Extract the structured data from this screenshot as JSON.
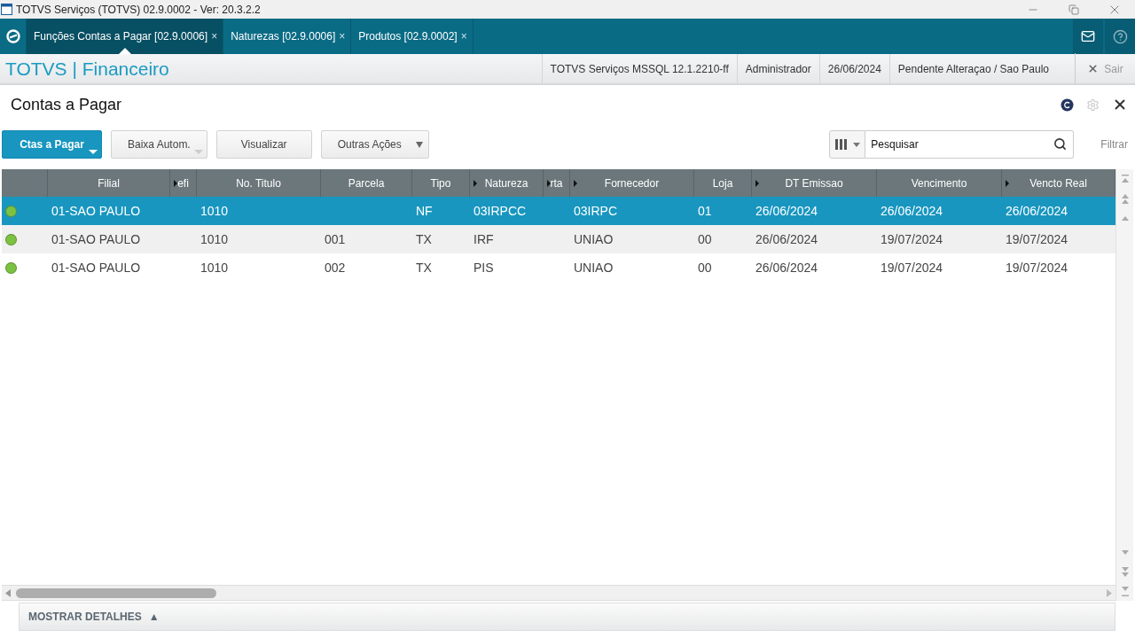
{
  "window": {
    "title": "TOTVS Serviços (TOTVS) 02.9.0002 - Ver: 20.3.2.2"
  },
  "tabs": [
    {
      "label": "Funções Contas a Pagar [02.9.0006]",
      "close": "×",
      "selected": true
    },
    {
      "label": "Naturezas [02.9.0006]",
      "close": "×",
      "selected": false
    },
    {
      "label": "Produtos [02.9.0002]",
      "close": "×",
      "selected": false
    }
  ],
  "app_bar": {
    "brand": "TOTVS | Financeiro",
    "info": [
      "TOTVS Serviços MSSQL 12.1.2210-ff",
      "Administrador",
      "26/06/2024",
      "Pendente Alteraçao / Sao Paulo"
    ],
    "exit": "Sair"
  },
  "page": {
    "title": "Contas a Pagar"
  },
  "actions": [
    {
      "label": "Ctas a Pagar",
      "kind": "primary",
      "dropdown": true
    },
    {
      "label": "Baixa Autom.",
      "kind": "secondary",
      "dropdown": true
    },
    {
      "label": "Visualizar",
      "kind": "secondary",
      "dropdown": false
    },
    {
      "label": "Outras Ações",
      "kind": "menu",
      "dropdown": false
    }
  ],
  "search": {
    "placeholder": "Pesquisar",
    "filter": "Filtrar"
  },
  "table": {
    "columns": [
      {
        "marker": false
      },
      {
        "label": "Filial",
        "marker": false
      },
      {
        "label": "efi",
        "marker": true
      },
      {
        "label": "No. Titulo",
        "marker": false
      },
      {
        "label": "Parcela",
        "marker": false
      },
      {
        "label": "Tipo",
        "marker": false
      },
      {
        "label": "Natureza",
        "marker": true
      },
      {
        "label": "rta",
        "marker": true
      },
      {
        "label": "Fornecedor",
        "marker": true
      },
      {
        "label": "Loja",
        "marker": false
      },
      {
        "label": "DT Emissao",
        "marker": true
      },
      {
        "label": "Vencimento",
        "marker": false
      },
      {
        "label": "Vencto Real",
        "marker": true
      }
    ],
    "rows": [
      {
        "selected": true,
        "color": "#7cc242",
        "cells": [
          "01-SAO PAULO",
          "",
          "1010",
          "",
          "NF",
          "03IRPCC",
          "",
          "03IRPC",
          "01",
          "26/06/2024",
          "26/06/2024",
          "26/06/2024"
        ]
      },
      {
        "selected": false,
        "color": "#7cc242",
        "cells": [
          "01-SAO PAULO",
          "",
          "1010",
          "001",
          "TX",
          "IRF",
          "",
          "UNIAO",
          "00",
          "26/06/2024",
          "19/07/2024",
          "19/07/2024"
        ]
      },
      {
        "selected": false,
        "color": "#7cc242",
        "cells": [
          "01-SAO PAULO",
          "",
          "1010",
          "002",
          "TX",
          "PIS",
          "",
          "UNIAO",
          "00",
          "26/06/2024",
          "19/07/2024",
          "19/07/2024"
        ]
      }
    ]
  },
  "details": {
    "label": "MOSTRAR DETALHES",
    "icon": "▲"
  }
}
